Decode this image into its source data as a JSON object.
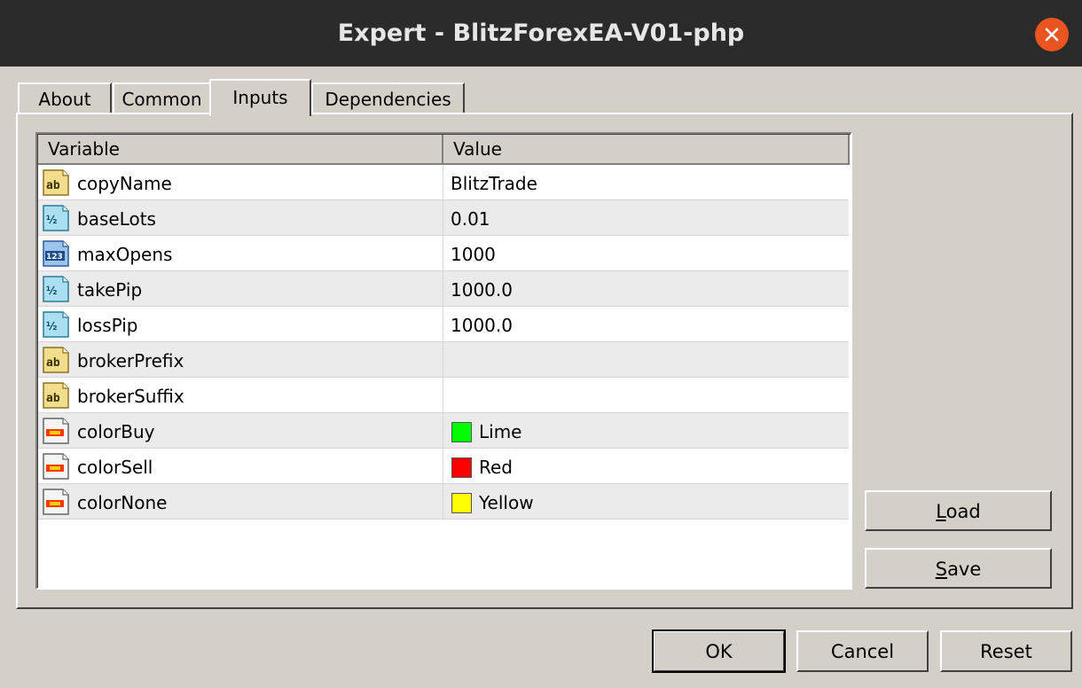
{
  "window": {
    "title": "Expert - BlitzForexEA-V01-php"
  },
  "tabs": [
    {
      "label": "About"
    },
    {
      "label": "Common"
    },
    {
      "label": "Inputs"
    },
    {
      "label": "Dependencies"
    }
  ],
  "active_tab": "Inputs",
  "grid": {
    "columns": [
      "Variable",
      "Value"
    ],
    "rows": [
      {
        "name": "copyName",
        "type_icon": "string-icon",
        "value": "BlitzTrade"
      },
      {
        "name": "baseLots",
        "type_icon": "double-icon",
        "value": "0.01"
      },
      {
        "name": "maxOpens",
        "type_icon": "integer-icon",
        "value": "1000"
      },
      {
        "name": "takePip",
        "type_icon": "double-icon",
        "value": "1000.0"
      },
      {
        "name": "lossPip",
        "type_icon": "double-icon",
        "value": "1000.0"
      },
      {
        "name": "brokerPrefix",
        "type_icon": "string-icon",
        "value": ""
      },
      {
        "name": "brokerSuffix",
        "type_icon": "string-icon",
        "value": ""
      },
      {
        "name": "colorBuy",
        "type_icon": "color-icon",
        "value": "Lime",
        "swatch": "#00ff00"
      },
      {
        "name": "colorSell",
        "type_icon": "color-icon",
        "value": "Red",
        "swatch": "#ff0000"
      },
      {
        "name": "colorNone",
        "type_icon": "color-icon",
        "value": "Yellow",
        "swatch": "#ffff00"
      }
    ]
  },
  "side_buttons": {
    "load": {
      "first": "L",
      "rest": "oad"
    },
    "save": {
      "first": "S",
      "rest": "ave"
    }
  },
  "footer": {
    "ok": "OK",
    "cancel": "Cancel",
    "reset": "Reset"
  },
  "colors": {
    "titlebar": "#2b2b2b",
    "close_button": "#e95420",
    "dialog_bg": "#d4d0c8"
  }
}
